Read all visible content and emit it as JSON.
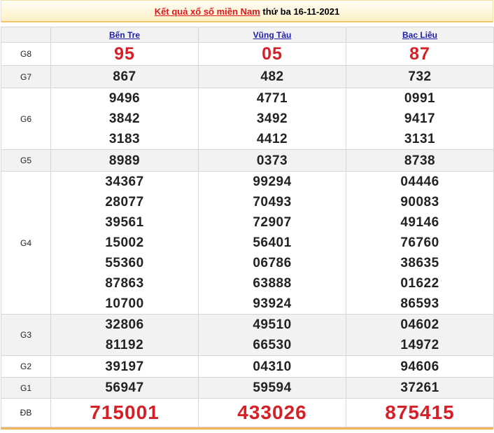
{
  "title": {
    "link_text": "Kết quả xổ số miền Nam",
    "rest": "thứ ba 16-11-2021"
  },
  "provinces": [
    "Bến Tre",
    "Vũng Tàu",
    "Bạc Liêu"
  ],
  "prizes": [
    {
      "label": "G8",
      "values": [
        [
          "95"
        ],
        [
          "05"
        ],
        [
          "87"
        ]
      ]
    },
    {
      "label": "G7",
      "values": [
        [
          "867"
        ],
        [
          "482"
        ],
        [
          "732"
        ]
      ]
    },
    {
      "label": "G6",
      "values": [
        [
          "9496",
          "3842",
          "3183"
        ],
        [
          "4771",
          "3492",
          "4412"
        ],
        [
          "0991",
          "9417",
          "3131"
        ]
      ]
    },
    {
      "label": "G5",
      "values": [
        [
          "8989"
        ],
        [
          "0373"
        ],
        [
          "8738"
        ]
      ]
    },
    {
      "label": "G4",
      "values": [
        [
          "34367",
          "28077",
          "39561",
          "15002",
          "55360",
          "87863",
          "10700"
        ],
        [
          "99294",
          "70493",
          "72907",
          "56401",
          "06786",
          "63888",
          "93924"
        ],
        [
          "04446",
          "90083",
          "49146",
          "76760",
          "38635",
          "01622",
          "86593"
        ]
      ]
    },
    {
      "label": "G3",
      "values": [
        [
          "32806",
          "81192"
        ],
        [
          "49510",
          "66530"
        ],
        [
          "04602",
          "14972"
        ]
      ]
    },
    {
      "label": "G2",
      "values": [
        [
          "39197"
        ],
        [
          "04310"
        ],
        [
          "94606"
        ]
      ]
    },
    {
      "label": "G1",
      "values": [
        [
          "56947"
        ],
        [
          "59594"
        ],
        [
          "37261"
        ]
      ]
    },
    {
      "label": "ĐB",
      "values": [
        [
          "715001"
        ],
        [
          "433026"
        ],
        [
          "875415"
        ]
      ]
    }
  ],
  "colors": {
    "accent_red": "#d61f26",
    "link_blue": "#1c1ca8",
    "title_red": "#e0161c",
    "border_gold": "#f0c46a"
  }
}
